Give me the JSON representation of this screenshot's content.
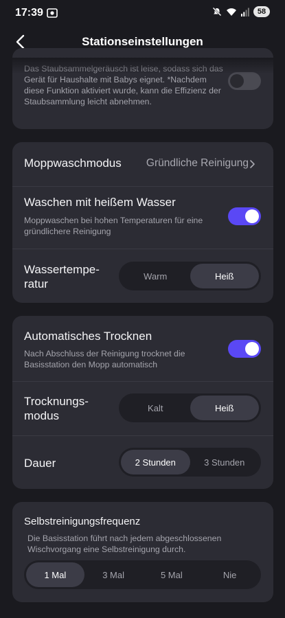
{
  "status_bar": {
    "time": "17:39",
    "battery": "58",
    "icons": [
      "screen-record-icon",
      "mute-icon",
      "wifi-icon",
      "signal-icon",
      "battery-icon"
    ]
  },
  "header": {
    "title": "Stationseinstellungen",
    "back_icon": "chevron-left-icon"
  },
  "dust_card": {
    "description": "Das Staubsammelgeräusch ist leise, sodass sich das Gerät für Haushalte mit Babys eignet. *Nachdem diese Funktion aktiviert wurde, kann die Effizienz der Staubsammlung leicht abnehmen.",
    "toggle_on": false
  },
  "mop_card": {
    "wash_mode_label": "Moppwaschmodus",
    "wash_mode_value": "Gründliche Reinigung",
    "hot_water_label": "Waschen mit heißem Wasser",
    "hot_water_desc": "Moppwaschen bei hohen Temperaturen für eine gründlichere Reinigung",
    "hot_water_on": true,
    "water_temp_label": "Wassertempe-ratur",
    "water_temp_options": [
      "Warm",
      "Heiß"
    ],
    "water_temp_selected": "Heiß"
  },
  "dry_card": {
    "auto_dry_label": "Automatisches Trocknen",
    "auto_dry_desc": "Nach Abschluss der Reinigung trocknet die Basisstation den Mopp automatisch",
    "auto_dry_on": true,
    "dry_mode_label": "Trocknungs-modus",
    "dry_mode_options": [
      "Kalt",
      "Heiß"
    ],
    "dry_mode_selected": "Heiß",
    "duration_label": "Dauer",
    "duration_options": [
      "2 Stunden",
      "3 Stunden"
    ],
    "duration_selected": "2 Stunden"
  },
  "freq_card": {
    "title": "Selbstreinigungsfrequenz",
    "description": "Die Basisstation führt nach jedem abgeschlossenen Wischvorgang eine Selbstreinigung durch.",
    "options": [
      "1 Mal",
      "3 Mal",
      "5 Mal",
      "Nie"
    ],
    "selected": "1 Mal"
  },
  "colors": {
    "background": "#1a1a1f",
    "card": "#2c2c34",
    "accent": "#5a48f5",
    "muted_text": "#a4a4ac"
  }
}
